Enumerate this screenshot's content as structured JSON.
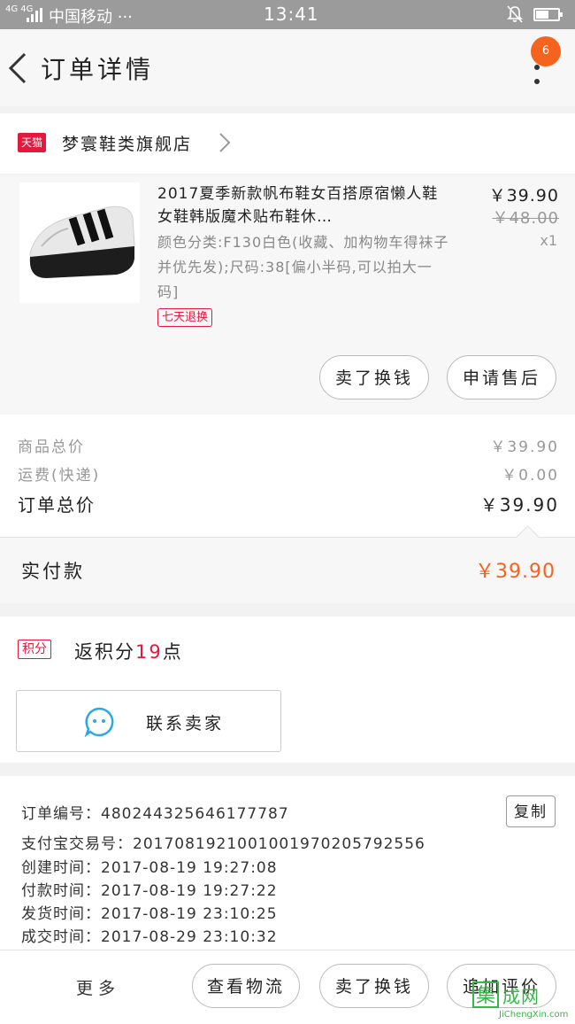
{
  "status_bar": {
    "network": "4G 4G",
    "carrier": "中国移动 ···",
    "time": "13:41"
  },
  "nav": {
    "title": "订单详情",
    "badge_count": "6",
    "icons": [
      "back-arrow-icon",
      "more-vertical-icon"
    ]
  },
  "shop": {
    "platform_label": "天猫",
    "name": "梦寰鞋类旗舰店"
  },
  "item": {
    "title": "2017夏季新款帆布鞋女百搭原宿懒人鞋女鞋韩版魔术贴布鞋休…",
    "sku": "颜色分类:F130白色(收藏、加构物车得袜子并优先发);尺码:38[偏小半码,可以拍大一码]",
    "return_tag": "七天退换",
    "price": "￥39.90",
    "original_price": "￥48.00",
    "quantity": "x1",
    "buttons": {
      "resell": "卖了换钱",
      "after_sales": "申请售后"
    }
  },
  "summary": {
    "goods_total_label": "商品总价",
    "goods_total_value": "￥39.90",
    "shipping_label": "运费(快递)",
    "shipping_value": "￥0.00",
    "order_total_label": "订单总价",
    "order_total_value": "￥39.90"
  },
  "paid": {
    "label": "实付款",
    "value": "￥39.90"
  },
  "points": {
    "tag": "积分",
    "prefix": "返积分",
    "count": "19",
    "suffix": "点",
    "contact_label": "联系卖家"
  },
  "order_info": {
    "copy_label": "复制",
    "lines": [
      "订单编号：480244325646177787",
      "支付宝交易号：2017081921001001970205792556",
      "创建时间：2017-08-19 19:27:08",
      "付款时间：2017-08-19 19:27:22",
      "发货时间：2017-08-19 23:10:25",
      "成交时间：2017-08-29 23:10:32"
    ]
  },
  "bottom_bar": {
    "more": "更多",
    "logistics": "查看物流",
    "resell": "卖了换钱",
    "review": "追加评价"
  },
  "watermark": {
    "glyph": "集",
    "cn": "成网",
    "en": "JiChengXin.com"
  },
  "colors": {
    "accent_orange": "#f5631f",
    "tmall_red": "#e5183e",
    "contact_blue": "#2aa8e8"
  }
}
